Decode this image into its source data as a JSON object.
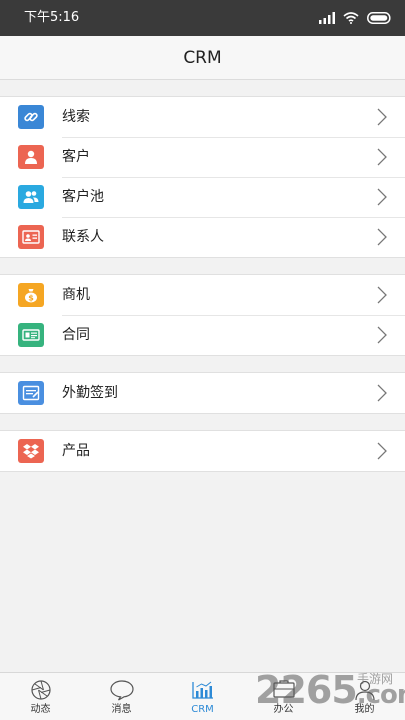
{
  "status_bar": {
    "time": "下午5:16"
  },
  "nav": {
    "title": "CRM"
  },
  "groups": [
    {
      "items": [
        {
          "label": "线索",
          "icon": "link-icon",
          "color": "#3a87d6"
        },
        {
          "label": "客户",
          "icon": "person-icon",
          "color": "#ec6552"
        },
        {
          "label": "客户池",
          "icon": "people-icon",
          "color": "#2aa9e0"
        },
        {
          "label": "联系人",
          "icon": "id-card-icon",
          "color": "#ec6552"
        }
      ]
    },
    {
      "items": [
        {
          "label": "商机",
          "icon": "money-bag-icon",
          "color": "#f5a623"
        },
        {
          "label": "合同",
          "icon": "contract-icon",
          "color": "#36b37e"
        }
      ]
    },
    {
      "items": [
        {
          "label": "外勤签到",
          "icon": "checkin-icon",
          "color": "#4a8fe0"
        }
      ]
    },
    {
      "items": [
        {
          "label": "产品",
          "icon": "dropbox-icon",
          "color": "#ec6552"
        }
      ]
    }
  ],
  "tabs": [
    {
      "label": "动态",
      "icon": "aperture-icon"
    },
    {
      "label": "消息",
      "icon": "chat-bubble-icon"
    },
    {
      "label": "CRM",
      "icon": "bar-chart-icon",
      "active": true
    },
    {
      "label": "办公",
      "icon": "office-icon"
    },
    {
      "label": "我的",
      "icon": "profile-icon"
    }
  ],
  "watermark": {
    "number": "2265",
    "suffix": ".com",
    "site": "手游网"
  },
  "colors": {
    "active_tab": "#2d8ad6",
    "status_bar_bg": "#3a3a3a"
  }
}
